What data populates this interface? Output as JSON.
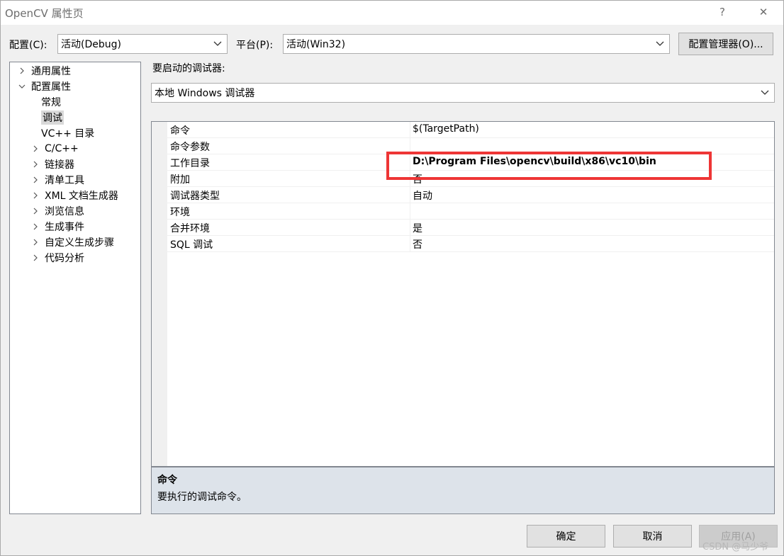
{
  "window": {
    "title": "OpenCV 属性页",
    "help_label": "?",
    "close_label": "✕"
  },
  "toolbar": {
    "config_label": "配置(C):",
    "config_value": "活动(Debug)",
    "platform_label": "平台(P):",
    "platform_value": "活动(Win32)",
    "config_manager_button": "配置管理器(O)..."
  },
  "tree": {
    "items": [
      {
        "label": "通用属性",
        "arrow": "right"
      },
      {
        "label": "配置属性",
        "arrow": "down"
      },
      {
        "label": "常规",
        "arrow": "none"
      },
      {
        "label": "调试",
        "arrow": "none",
        "selected": true
      },
      {
        "label": "VC++ 目录",
        "arrow": "none"
      },
      {
        "label": "C/C++",
        "arrow": "right"
      },
      {
        "label": "链接器",
        "arrow": "right"
      },
      {
        "label": "清单工具",
        "arrow": "right"
      },
      {
        "label": "XML 文档生成器",
        "arrow": "right"
      },
      {
        "label": "浏览信息",
        "arrow": "right"
      },
      {
        "label": "生成事件",
        "arrow": "right"
      },
      {
        "label": "自定义生成步骤",
        "arrow": "right"
      },
      {
        "label": "代码分析",
        "arrow": "right"
      }
    ]
  },
  "debugger": {
    "label": "要启动的调试器:",
    "value": "本地 Windows 调试器"
  },
  "properties": [
    {
      "name": "命令",
      "value": "$(TargetPath)",
      "bold": false
    },
    {
      "name": "命令参数",
      "value": "",
      "bold": false
    },
    {
      "name": "工作目录",
      "value": "D:\\Program Files\\opencv\\build\\x86\\vc10\\bin",
      "bold": true
    },
    {
      "name": "附加",
      "value": "否",
      "bold": false
    },
    {
      "name": "调试器类型",
      "value": "自动",
      "bold": false
    },
    {
      "name": "环境",
      "value": "",
      "bold": false
    },
    {
      "name": "合并环境",
      "value": "是",
      "bold": false
    },
    {
      "name": "SQL 调试",
      "value": "否",
      "bold": false
    }
  ],
  "description": {
    "title": "命令",
    "text": "要执行的调试命令。"
  },
  "buttons": {
    "ok": "确定",
    "cancel": "取消",
    "apply": "应用(A)"
  },
  "watermark": "CSDN @马少爷",
  "colors": {
    "highlight": "#ee3535",
    "desc_background": "#dde3ea"
  }
}
